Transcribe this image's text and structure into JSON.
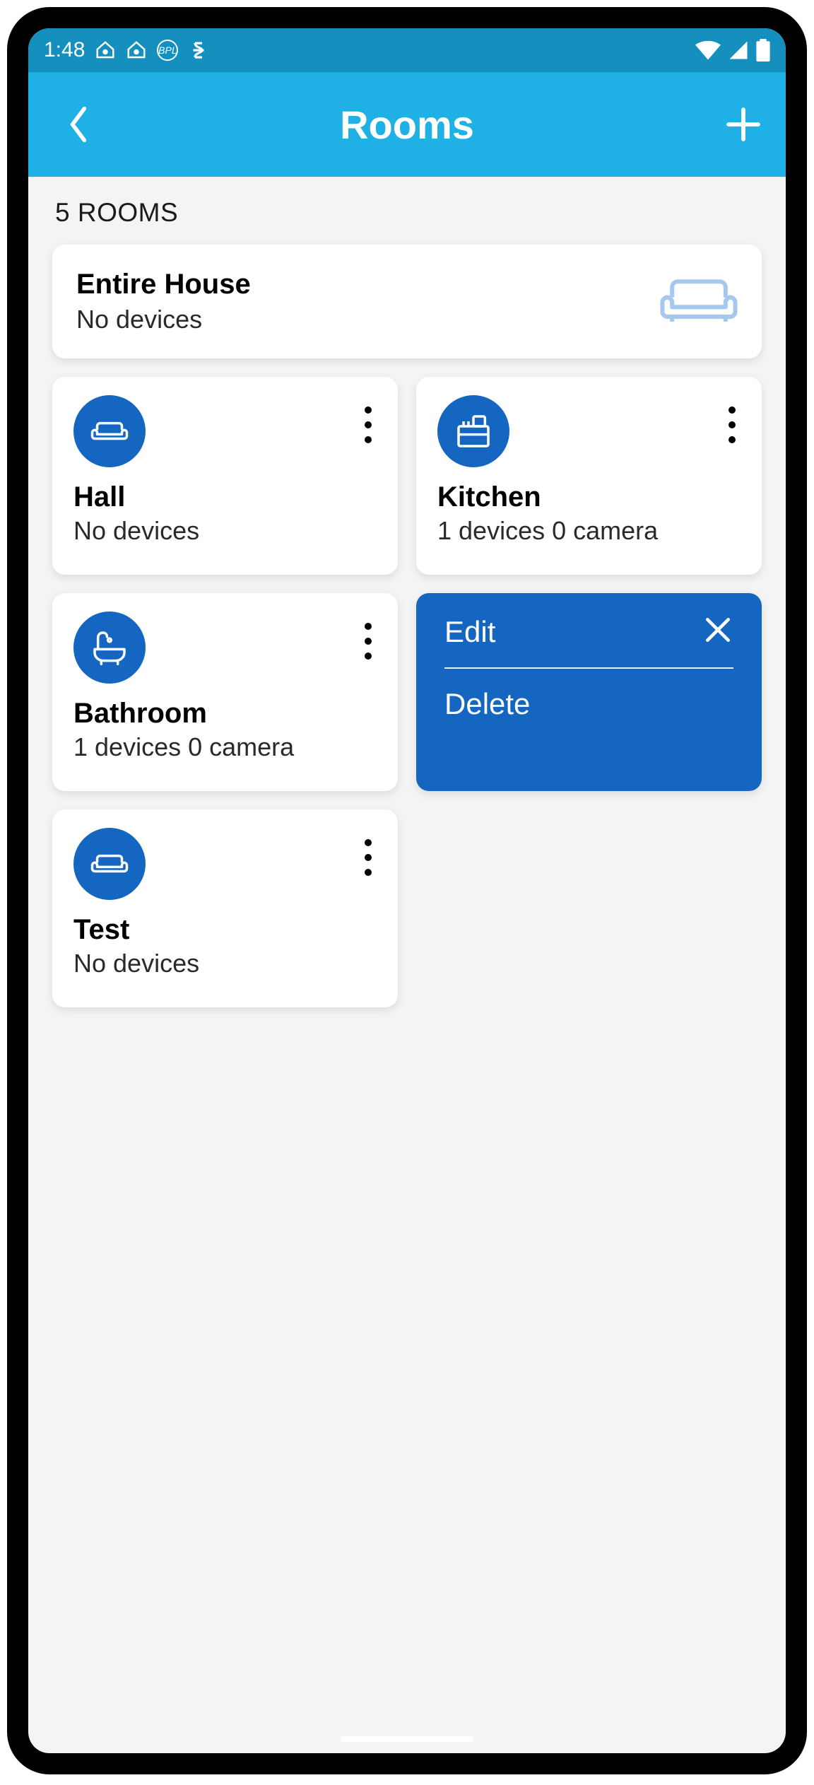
{
  "statusbar": {
    "time": "1:48"
  },
  "appbar": {
    "title": "Rooms"
  },
  "section_label": "5 ROOMS",
  "entire": {
    "name": "Entire House",
    "sub": "No devices"
  },
  "rooms": [
    {
      "name": "Hall",
      "sub": "No devices",
      "icon": "couch"
    },
    {
      "name": "Kitchen",
      "sub": "1 devices 0 camera",
      "icon": "kitchen"
    },
    {
      "name": "Bathroom",
      "sub": "1 devices 0 camera",
      "icon": "bath"
    },
    {
      "name": "Test",
      "sub": "No devices",
      "icon": "couch"
    }
  ],
  "menu": {
    "edit": "Edit",
    "delete": "Delete"
  },
  "colors": {
    "statusbar": "#148fbe",
    "appbar": "#1fb0e6",
    "accent": "#1566c0",
    "couch_outline": "#a7c8ee"
  }
}
